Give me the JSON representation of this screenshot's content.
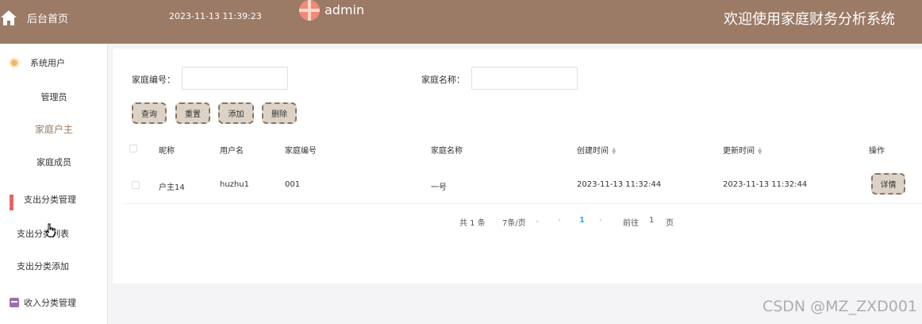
{
  "header": {
    "home_label": "后台首页",
    "datetime": "2023-11-13 11:39:23",
    "username": "admin",
    "site_title": "欢迎使用家庭财务分析系统",
    "bg_color": "#9b7a66"
  },
  "sidebar": {
    "group_system": "系统用户",
    "item_admin": "管理员",
    "item_householder": "家庭户主",
    "item_member": "家庭成员",
    "group_expense": "支出分类管理",
    "item_expense_list": "支出分类列表",
    "item_expense_add": "支出分类添加",
    "group_income": "收入分类管理",
    "active_color": "#9b7a66"
  },
  "search": {
    "family_no_label": "家庭编号：",
    "family_no_value": "",
    "family_name_label": "家庭名称：",
    "family_name_value": ""
  },
  "toolbar": {
    "query": "查询",
    "reset": "重置",
    "add": "添加",
    "delete": "删除"
  },
  "table": {
    "headers": [
      "昵称",
      "用户名",
      "家庭编号",
      "家庭名称",
      "创建时间",
      "更新时间",
      "操作"
    ],
    "rows": [
      {
        "nickname": "户主14",
        "username": "huzhu1",
        "family_no": "001",
        "family_name": "一号",
        "created": "2023-11-13 11:32:44",
        "updated": "2023-11-13 11:32:44",
        "action": "详情"
      }
    ]
  },
  "pagination": {
    "total": "共 1 条",
    "page_size": "7条/页",
    "current_page": "1",
    "goto_label": "前往",
    "goto_value": "1",
    "page_suffix": "页"
  },
  "watermark": "CSDN @MZ_ZXD001"
}
